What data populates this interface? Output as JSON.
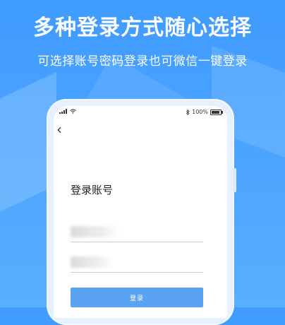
{
  "banner": {
    "headline": "多种登录方式随心选择",
    "subheadline": "可选择账号密码登录也可微信一键登录"
  },
  "status_bar": {
    "battery": "100%"
  },
  "login": {
    "title": "登录账号",
    "account_value": "",
    "password_value": "",
    "login_label": "登录"
  },
  "icons": {
    "back": "back-chevron-icon",
    "signal": "signal-icon",
    "wifi": "wifi-icon",
    "bluetooth": "bluetooth-icon",
    "battery": "battery-icon"
  },
  "colors": {
    "background": "#4aa3ff",
    "button": "#5aa2f2"
  }
}
